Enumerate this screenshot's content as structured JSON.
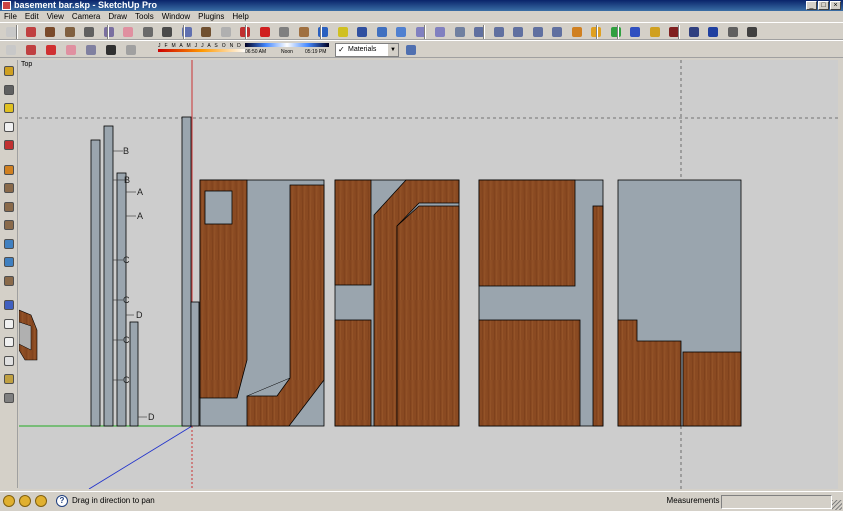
{
  "window": {
    "title": "basement bar.skp - SketchUp Pro",
    "buttons": [
      "_",
      "□",
      "×"
    ]
  },
  "menu": [
    "File",
    "Edit",
    "View",
    "Camera",
    "Draw",
    "Tools",
    "Window",
    "Plugins",
    "Help"
  ],
  "shadow": {
    "months": "J F M A M J J A S O N D",
    "time_start": "06:50 AM",
    "time_noon": "Noon",
    "time_end": "05:19 PM"
  },
  "style_select": {
    "value": "Materials",
    "check": "✓"
  },
  "viewport": {
    "scene_label": "Top",
    "section_labels": [
      "B",
      "B",
      "A",
      "A",
      "C",
      "C",
      "D",
      "C",
      "C",
      "D"
    ]
  },
  "statusbar": {
    "help_glyph": "?",
    "hint": "Drag in direction to pan",
    "measurements_label": "Measurements",
    "measurements_value": ""
  },
  "colors": {
    "wood": "#8a4a22",
    "panel": "#9aa5ae",
    "background": "#cdcdcd",
    "axis_red": "#cc2222",
    "axis_green": "#22aa22",
    "axis_blue": "#2233cc",
    "chrome": "#d4d0c8"
  },
  "icons": {
    "toolbar_row1": [
      "select-icon",
      "pencil-icon",
      "rectangle-icon",
      "circle-icon",
      "arc-icon",
      "polygon-icon",
      "eraser-icon",
      "tape-measure-icon",
      "text-icon",
      "paint-bucket-icon",
      "push-pull-icon",
      "follow-me-icon",
      "move-icon",
      "rotate-icon",
      "offset-icon",
      "scale-icon",
      "orbit-icon",
      "pan-icon",
      "zoom-icon",
      "zoom-window-icon",
      "zoom-extents-icon",
      "previous-view-icon",
      "next-view-icon",
      "iso-view-icon",
      "top-view-icon",
      "front-view-icon",
      "right-view-icon",
      "back-view-icon",
      "left-view-icon",
      "warehouse-icon",
      "components-icon",
      "google-earth-icon",
      "info-icon",
      "pencil-plugin-icon",
      "dropper-icon",
      "export-icon",
      "help-icon",
      "settings-icon",
      "close-plugin-icon"
    ],
    "left_tools": [
      "paint-icon",
      "sandbox-icon",
      "measure-icon",
      "dimension-icon",
      "axis-icon",
      "section-icon",
      "box-iso-icon",
      "box-top-icon",
      "box-front-icon",
      "box-right-icon",
      "box-back-icon",
      "box-left-icon",
      "xray-icon",
      "wireframe-icon",
      "hidden-line-icon",
      "shaded-icon",
      "textured-icon",
      "monochrome-icon"
    ]
  }
}
